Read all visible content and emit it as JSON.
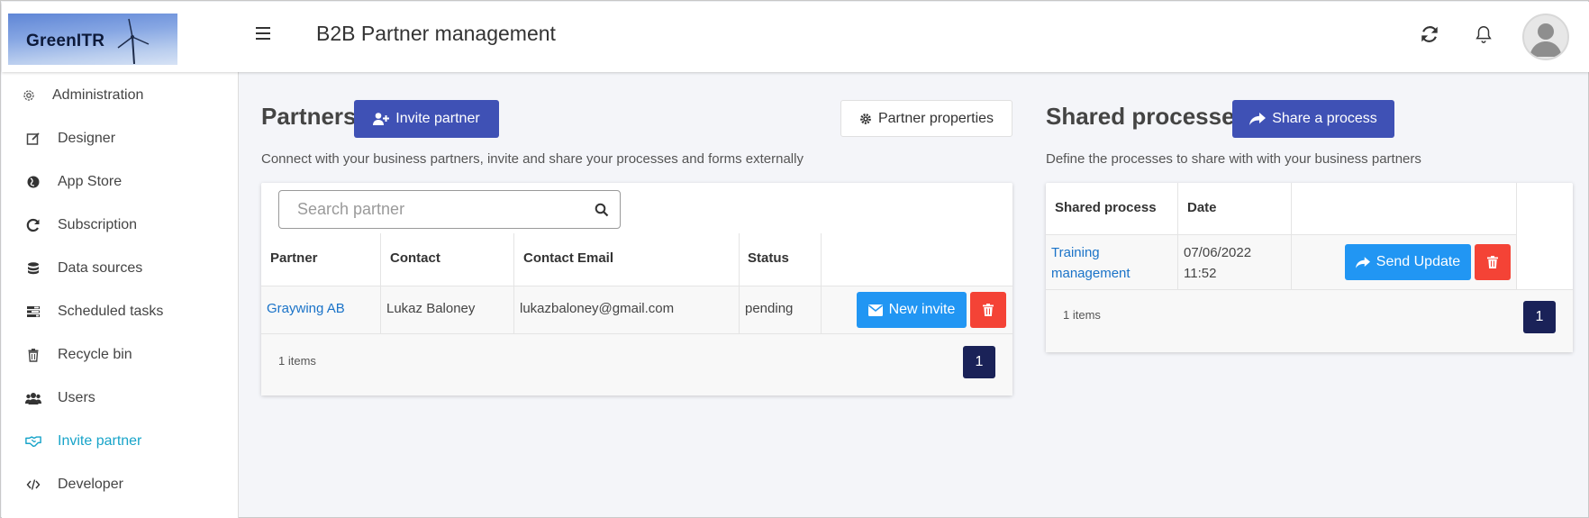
{
  "app": {
    "logo_text": "GreenITR",
    "page_title": "B2B Partner management"
  },
  "sidebar": {
    "items": [
      {
        "label": "Administration",
        "icon": "gear-icon"
      },
      {
        "label": "Designer",
        "icon": "edit-icon"
      },
      {
        "label": "App Store",
        "icon": "globe-icon"
      },
      {
        "label": "Subscription",
        "icon": "refresh-icon"
      },
      {
        "label": "Data sources",
        "icon": "database-icon"
      },
      {
        "label": "Scheduled tasks",
        "icon": "tasks-icon"
      },
      {
        "label": "Recycle bin",
        "icon": "trash-icon"
      },
      {
        "label": "Users",
        "icon": "users-icon"
      },
      {
        "label": "Invite partner",
        "icon": "handshake-icon",
        "active": true
      },
      {
        "label": "Developer",
        "icon": "code-icon"
      }
    ]
  },
  "partners": {
    "title": "Partners",
    "invite_label": "Invite partner",
    "properties_label": "Partner properties",
    "description": "Connect with your business partners, invite and share your processes and forms externally",
    "search_placeholder": "Search partner",
    "columns": [
      "Partner",
      "Contact",
      "Contact Email",
      "Status"
    ],
    "rows": [
      {
        "partner": "Graywing AB",
        "contact": "Lukaz Baloney",
        "email": "lukazbaloney@gmail.com",
        "status": "pending"
      }
    ],
    "new_invite_label": "New invite",
    "items_count": "1 items",
    "page": "1"
  },
  "shared": {
    "title": "Shared processes",
    "share_label": "Share a process",
    "description": "Define the processes to share with with your business partners",
    "columns": [
      "Shared process",
      "Date"
    ],
    "rows": [
      {
        "process_line1": "Training",
        "process_line2": "management",
        "date_line1": "07/06/2022",
        "date_line2": "11:52"
      }
    ],
    "send_update_label": "Send Update",
    "items_count": "1 items",
    "page": "1"
  },
  "colors": {
    "primary": "#3f51b5",
    "blue": "#2196f3",
    "danger": "#f44336",
    "active_nav": "#18a4c9",
    "pagination": "#1a2258"
  }
}
